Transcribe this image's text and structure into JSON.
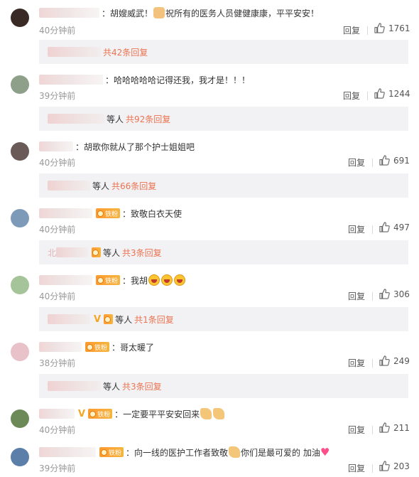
{
  "labels": {
    "reply": "回复",
    "colon": "：",
    "fan": "铁粉",
    "deng": "等人"
  },
  "comments": [
    {
      "text": "胡嫂威武！",
      "text2": "祝所有的医务人员健健康康，平平安安！",
      "time": "40分钟前",
      "likes": "1761",
      "sub_prefix": "",
      "sub_deng": "",
      "sub_count": "共42条回复",
      "avatar_color": "#3a2a26"
    },
    {
      "text": "哈哈哈哈哈记得还我，我才是！！！",
      "text2": "",
      "time": "39分钟前",
      "likes": "1244",
      "sub_prefix": "",
      "sub_deng": "等人",
      "sub_count": "共92条回复",
      "avatar_color": "#8fa08a"
    },
    {
      "text": "胡歌你就从了那个护士姐姐吧",
      "text2": "",
      "time": "40分钟前",
      "likes": "691",
      "sub_prefix": "",
      "sub_deng": "等人",
      "sub_count": "共66条回复",
      "avatar_color": "#6a5a58"
    },
    {
      "text": "致敬白衣天使",
      "text2": "",
      "time": "40分钟前",
      "likes": "497",
      "sub_prefix": "北",
      "sub_deng": "等人",
      "sub_count": "共3条回复",
      "avatar_color": "#7d9bb8"
    },
    {
      "text": "我胡",
      "text2": "",
      "time": "40分钟前",
      "likes": "306",
      "sub_prefix": "",
      "sub_deng": "等人",
      "sub_count": "共1条回复",
      "avatar_color": "#a6c49a"
    },
    {
      "text": "哥太暖了",
      "text2": "",
      "time": "38分钟前",
      "likes": "249",
      "sub_prefix": "",
      "sub_deng": "等人",
      "sub_count": "共3条回复",
      "avatar_color": "#e8c2c8"
    },
    {
      "text": "一定要平平安安回来",
      "text2": "",
      "time": "40分钟前",
      "likes": "211",
      "sub_prefix": "",
      "sub_deng": "",
      "sub_count": "",
      "avatar_color": "#6c8a58"
    },
    {
      "text": "向一线的医护工作者致敬",
      "text2": "你们是最可爱的 加油",
      "time": "39分钟前",
      "likes": "203",
      "sub_prefix": "",
      "sub_deng": "",
      "sub_count": "",
      "avatar_color": "#5b7fa8"
    }
  ]
}
